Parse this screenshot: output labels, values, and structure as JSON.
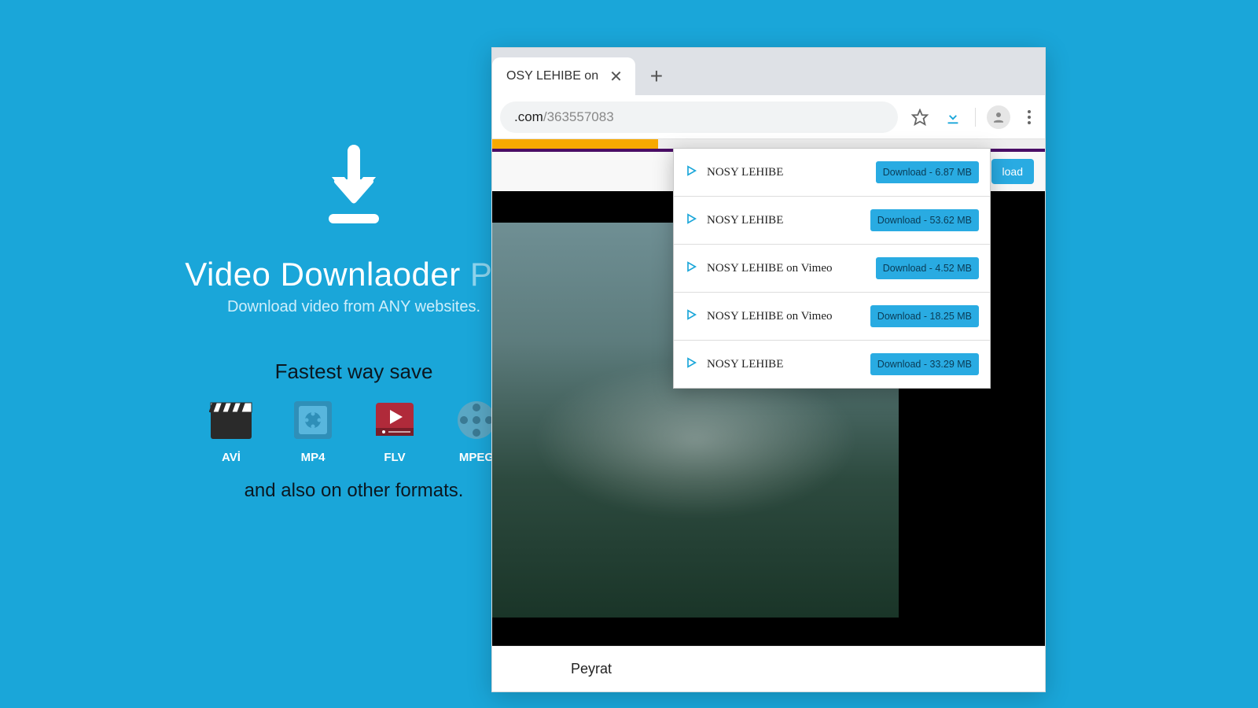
{
  "promo": {
    "title_main": "Video Downlaoder",
    "title_suffix": "Pro",
    "subtitle": "Download video from ANY websites.",
    "fastest": "Fastest way save",
    "formats": [
      "AVİ",
      "MP4",
      "FLV",
      "MPEG"
    ],
    "also": "and also on other formats."
  },
  "browser": {
    "tab_title": "OSY LEHIBE on",
    "url_domain": ".com",
    "url_path": "/363557083",
    "side_button": "load",
    "credit": "Peyrat"
  },
  "popup": {
    "items": [
      {
        "title": "NOSY LEHIBE",
        "button": "Download - 6.87 MB"
      },
      {
        "title": "NOSY LEHIBE",
        "button": "Download - 53.62 MB"
      },
      {
        "title": "NOSY LEHIBE on Vimeo",
        "button": "Download - 4.52 MB"
      },
      {
        "title": "NOSY LEHIBE on Vimeo",
        "button": "Download - 18.25 MB"
      },
      {
        "title": "NOSY LEHIBE",
        "button": "Download - 33.29 MB"
      }
    ]
  }
}
